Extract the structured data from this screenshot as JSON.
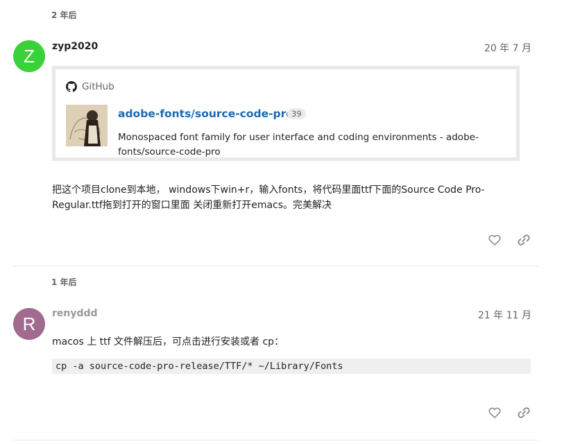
{
  "posts": [
    {
      "time_gap": "2 年后",
      "avatar_letter": "Z",
      "avatar_color": "#3ad23a",
      "username": "zyp2020",
      "date": "20 年 7 月",
      "onebox": {
        "source": "GitHub",
        "title": "adobe-fonts/source-code-pro",
        "badge": "39",
        "description": "Monospaced font family for user interface and coding environments - adobe-fonts/source-code-pro"
      },
      "body": "把这个项目clone到本地， windows下win+r，输入fonts，将代码里面ttf下面的Source Code Pro-Regular.ttf拖到打开的窗口里面 关闭重新打开emacs。完美解决"
    },
    {
      "time_gap": "1 年后",
      "avatar_letter": "R",
      "avatar_color": "#a26a8e",
      "username": "renyddd",
      "date": "21 年 11 月",
      "body": "macos 上 ttf 文件解压后，可点击进行安装或者 cp：",
      "code": "cp -a source-code-pro-release/TTF/* ~/Library/Fonts"
    }
  ],
  "icons": {
    "like": "heart-outline-icon",
    "share": "link-icon",
    "source": "github-icon"
  },
  "colors": {
    "link": "#1a6ab2",
    "muted": "#646464",
    "action_icon": "#8f8f8f"
  }
}
